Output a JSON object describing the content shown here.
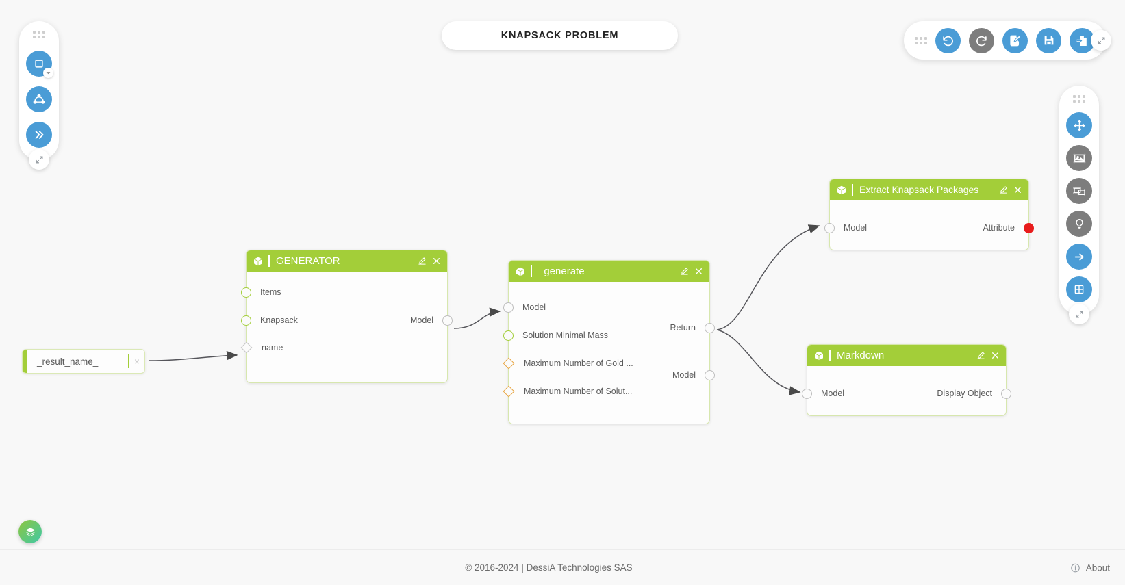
{
  "app": {
    "title": "KNAPSACK PROBLEM",
    "colors": {
      "node_header_green": "#a3ce39",
      "accent_blue": "#4a9cd6",
      "disabled_grey": "#7d7d7d",
      "port_green": "#a3ce39",
      "port_orange": "#e8a33d",
      "port_red": "#e81c1c",
      "canvas_bg": "#f8f8f8"
    }
  },
  "toolbar_top": {
    "grip": "drag-handle",
    "buttons": [
      {
        "name": "undo-button",
        "icon": "undo-icon",
        "state": "enabled",
        "color": "#4a9cd6"
      },
      {
        "name": "redo-button",
        "icon": "redo-icon",
        "state": "disabled",
        "color": "#7d7d7d"
      },
      {
        "name": "edit-script-button",
        "icon": "edit-document-icon",
        "state": "enabled",
        "color": "#4a9cd6"
      },
      {
        "name": "save-button",
        "icon": "floppy-disk-icon",
        "state": "enabled",
        "color": "#4a9cd6"
      },
      {
        "name": "export-button",
        "icon": "file-export-icon",
        "state": "enabled",
        "color": "#4a9cd6"
      }
    ],
    "collapse": "collapse-toolbar-icon"
  },
  "toolbar_left": {
    "grip": "drag-handle",
    "buttons": [
      {
        "name": "add-block-button",
        "icon": "square-block-icon",
        "color": "#4a9cd6",
        "has_dropdown": true
      },
      {
        "name": "workflow-graph-button",
        "icon": "node-graph-icon",
        "color": "#4a9cd6",
        "has_dropdown": false
      },
      {
        "name": "run-button",
        "icon": "double-chevron-right-icon",
        "color": "#4a9cd6",
        "has_dropdown": false
      }
    ],
    "collapse": "collapse-toolbar-icon"
  },
  "toolbar_right": {
    "grip": "drag-handle",
    "buttons": [
      {
        "name": "pan-tool-button",
        "icon": "move-arrows-icon",
        "state": "active",
        "color": "#4a9cd6"
      },
      {
        "name": "fit-to-view-button",
        "icon": "fit-image-icon",
        "state": "inactive",
        "color": "#7d7d7d"
      },
      {
        "name": "fit-selection-button",
        "icon": "fit-selection-icon",
        "state": "inactive",
        "color": "#7d7d7d"
      },
      {
        "name": "hints-button",
        "icon": "lightbulb-icon",
        "state": "inactive",
        "color": "#7d7d7d"
      },
      {
        "name": "arrow-right-button",
        "icon": "arrow-right-icon",
        "state": "active",
        "color": "#4a9cd6"
      },
      {
        "name": "grid-toggle-button",
        "icon": "grid-icon",
        "state": "active",
        "color": "#4a9cd6"
      }
    ],
    "collapse": "collapse-toolbar-icon"
  },
  "text_node": {
    "value": "_result_name_",
    "placeholder": "_result_name_",
    "clear_label": "×"
  },
  "nodes": [
    {
      "name": "generator-node",
      "title": "GENERATOR",
      "icon": "cube-icon",
      "edit_icon": "edit-pencil-icon",
      "close_icon": "close-x-icon",
      "inputs": [
        {
          "label": "Items",
          "shape": "circle",
          "color": "green"
        },
        {
          "label": "Knapsack",
          "shape": "circle",
          "color": "green"
        },
        {
          "label": "name",
          "shape": "diamond",
          "color": "grey"
        }
      ],
      "outputs": [
        {
          "label": "Model",
          "shape": "circle",
          "color": "grey"
        }
      ]
    },
    {
      "name": "generate-node",
      "title": "_generate_",
      "icon": "cube-icon",
      "edit_icon": "edit-pencil-icon",
      "close_icon": "close-x-icon",
      "inputs": [
        {
          "label": "Model",
          "shape": "circle",
          "color": "grey"
        },
        {
          "label": "Solution Minimal Mass",
          "shape": "circle",
          "color": "green"
        },
        {
          "label": "Maximum Number of Gold ...",
          "shape": "diamond",
          "color": "orange"
        },
        {
          "label": "Maximum Number of Solut...",
          "shape": "diamond",
          "color": "orange"
        }
      ],
      "outputs": [
        {
          "label": "Return",
          "shape": "circle",
          "color": "grey"
        },
        {
          "label": "Model",
          "shape": "circle",
          "color": "grey"
        }
      ]
    },
    {
      "name": "extract-knapsack-packages-node",
      "title": "Extract Knapsack Packages",
      "icon": "cube-icon",
      "edit_icon": "edit-pencil-icon",
      "close_icon": "close-x-icon",
      "inputs": [
        {
          "label": "Model",
          "shape": "circle",
          "color": "grey"
        }
      ],
      "outputs": [
        {
          "label": "Attribute",
          "shape": "circle",
          "color": "red"
        }
      ]
    },
    {
      "name": "markdown-node",
      "title": "Markdown",
      "icon": "cube-icon",
      "edit_icon": "edit-pencil-icon",
      "close_icon": "close-x-icon",
      "inputs": [
        {
          "label": "Model",
          "shape": "circle",
          "color": "grey"
        }
      ],
      "outputs": [
        {
          "label": "Display Object",
          "shape": "circle",
          "color": "grey"
        }
      ]
    }
  ],
  "connections": [
    {
      "from": "text-node:_result_name_",
      "to": "generator-node:name"
    },
    {
      "from": "generator-node:Model",
      "to": "generate-node:Model"
    },
    {
      "from": "generate-node:Return",
      "to": "extract-knapsack-packages-node:Model"
    },
    {
      "from": "generate-node:Return",
      "to": "markdown-node:Model"
    }
  ],
  "layers_fab": {
    "name": "layers-button",
    "icon": "layers-stack-icon"
  },
  "footer": {
    "copyright": "© 2016-2024 | DessiA Technologies SAS",
    "about_label": "About",
    "about_icon": "info-circle-icon"
  }
}
